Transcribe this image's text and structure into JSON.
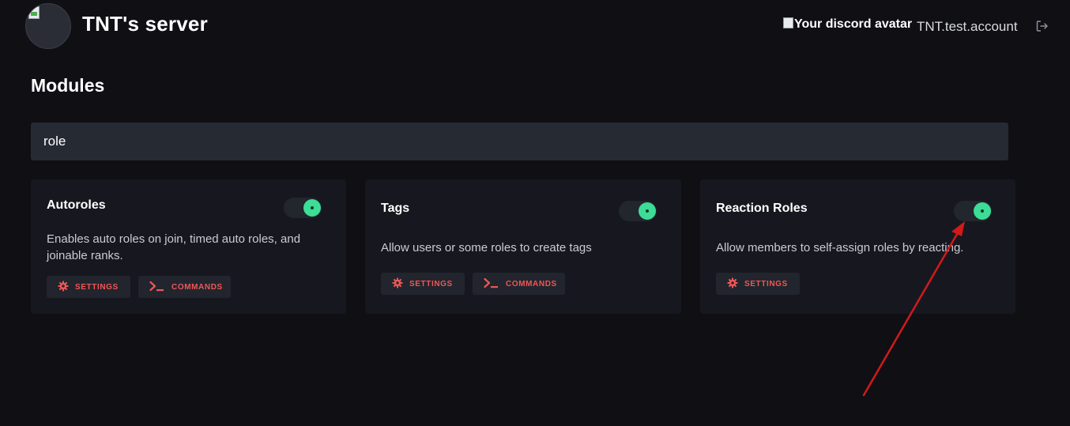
{
  "header": {
    "server_name": "TNT's server",
    "avatar_alt": "Your discord avatar",
    "username": "TNT.test.account"
  },
  "page": {
    "title": "Modules"
  },
  "search": {
    "value": "role"
  },
  "modules": [
    {
      "title": "Autoroles",
      "description": "Enables auto roles on join, timed auto roles, and joinable ranks.",
      "enabled": true,
      "settings_label": "SETTINGS",
      "commands_label": "COMMANDS"
    },
    {
      "title": "Tags",
      "description": "Allow users or some roles to create tags",
      "enabled": true,
      "settings_label": "SETTINGS",
      "commands_label": "COMMANDS"
    },
    {
      "title": "Reaction Roles",
      "description": "Allow members to self-assign roles by reacting.",
      "enabled": true,
      "settings_label": "SETTINGS"
    }
  ],
  "colors": {
    "background": "#0f0f14",
    "card": "#17181f",
    "accent_red": "#ef5656",
    "toggle_on": "#3ddc97",
    "annotation_arrow": "#d11a1a"
  },
  "icons": {
    "logout": "logout-icon",
    "settings": "gear-icon",
    "commands": "terminal-icon"
  }
}
